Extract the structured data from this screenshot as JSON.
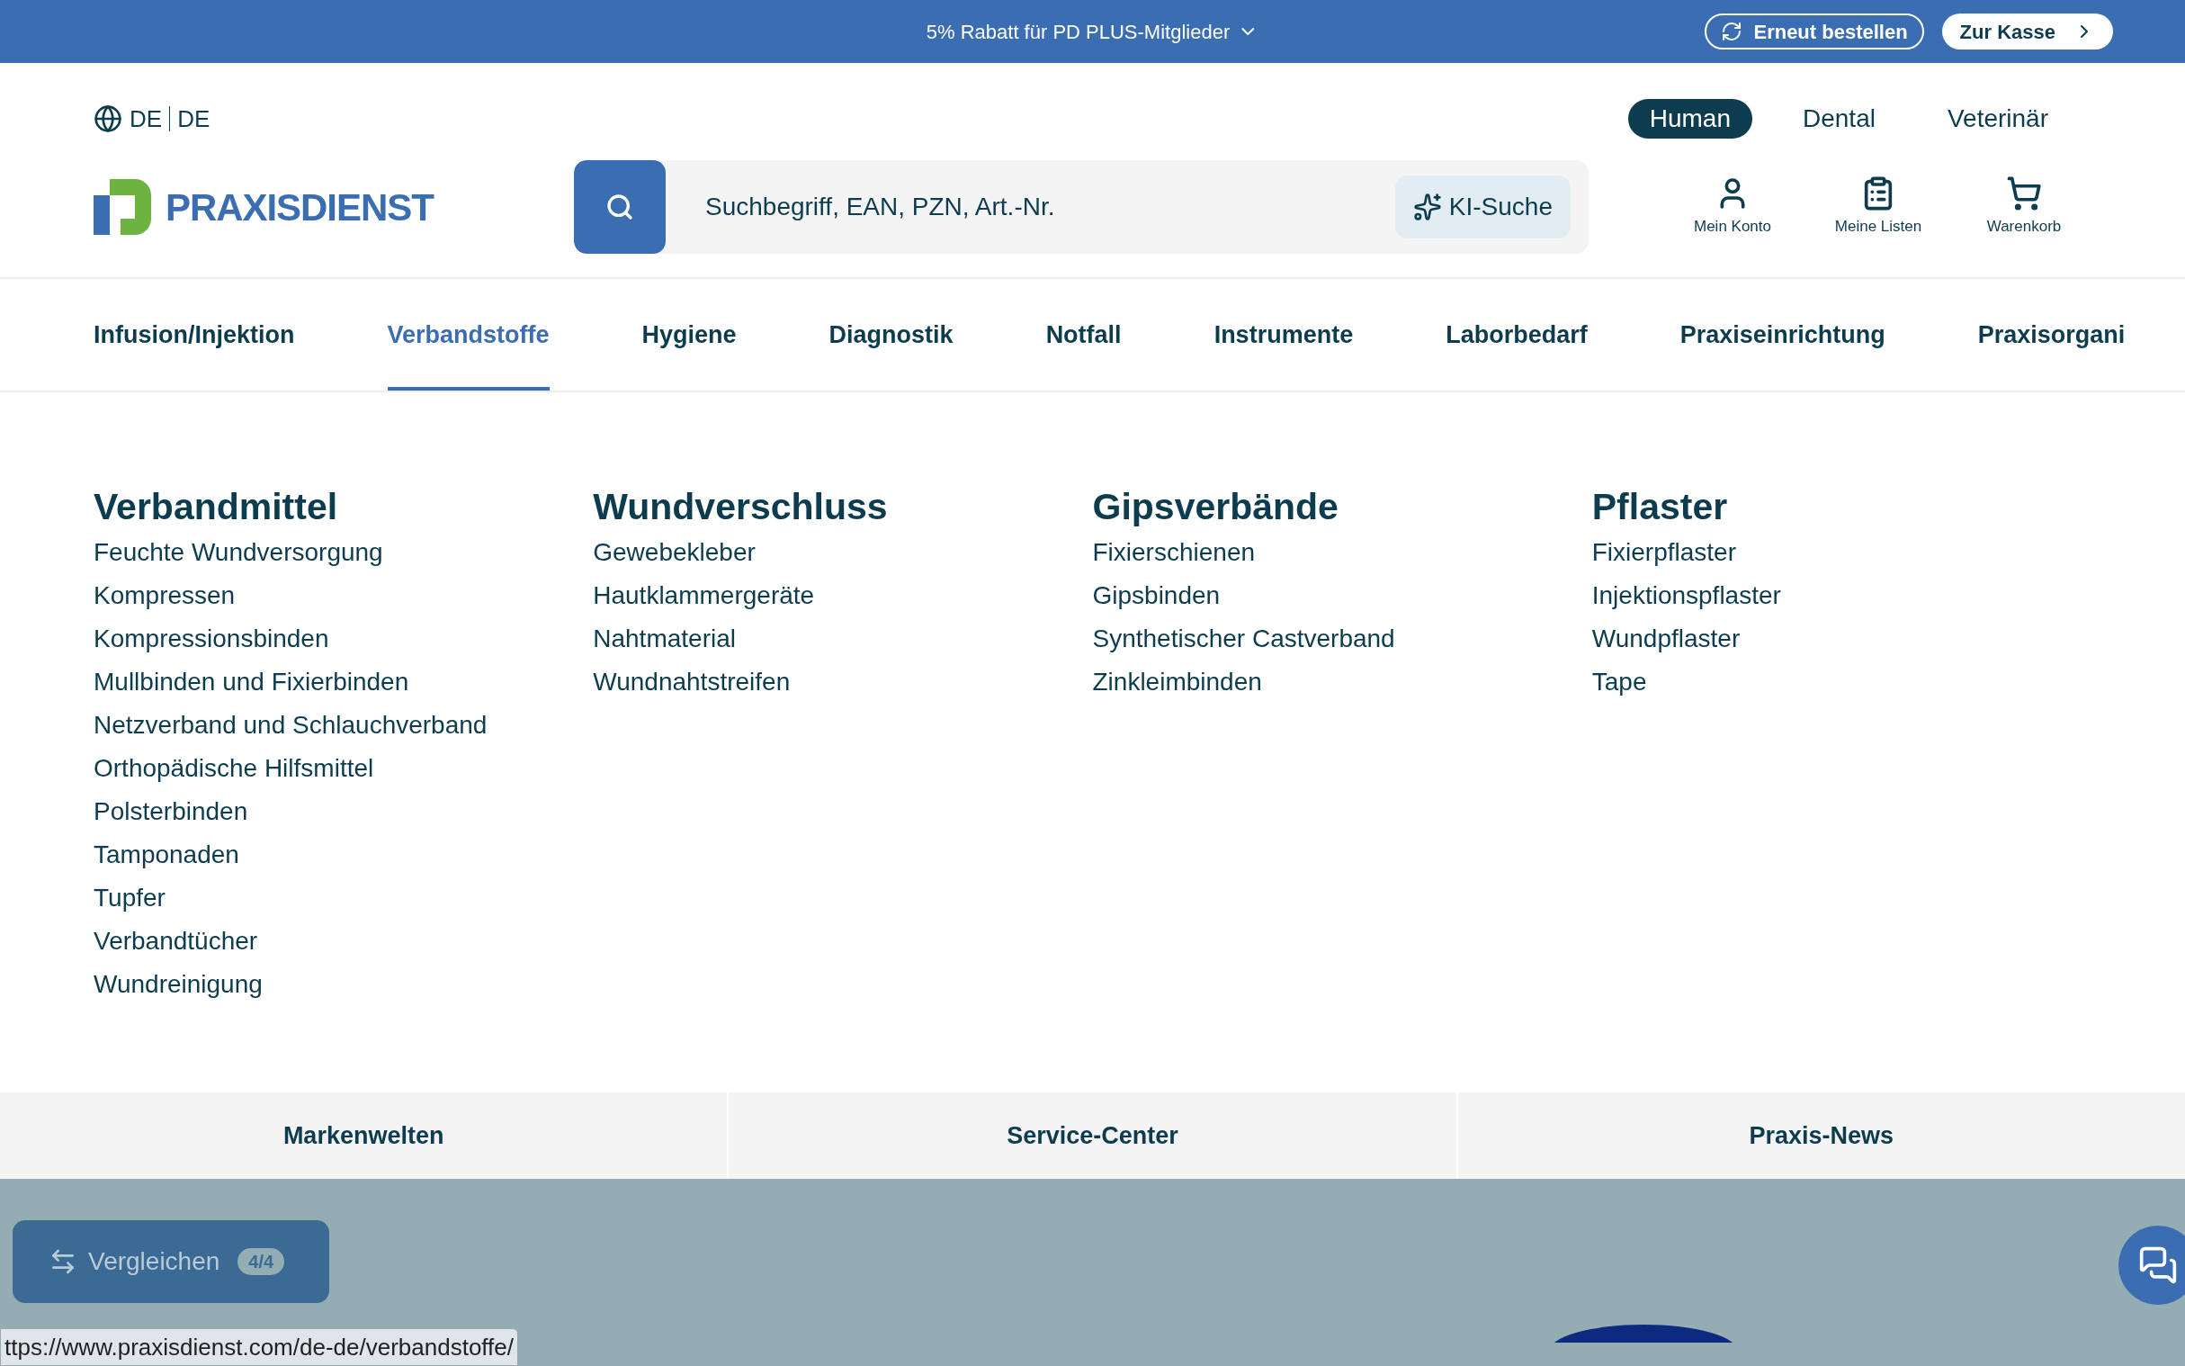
{
  "promo_bar": {
    "text": "5% Rabatt für PD PLUS-Mitglieder",
    "buttons": [
      {
        "kind": "reorder",
        "label": "Erneut bestellen"
      },
      {
        "kind": "checkout",
        "label": "Zur Kasse"
      }
    ]
  },
  "language": {
    "language": "DE",
    "country": "DE"
  },
  "segments": [
    {
      "label": "Human",
      "selected": true
    },
    {
      "label": "Dental",
      "selected": false
    },
    {
      "label": "Veterinär",
      "selected": false
    }
  ],
  "logo": {
    "text": "PRAXISDIENST"
  },
  "search": {
    "placeholder": "Suchbegriff, EAN, PZN, Art.-Nr.",
    "ai_button": "KI-Suche"
  },
  "account_links": [
    {
      "kind": "account",
      "label": "Mein Konto"
    },
    {
      "kind": "lists",
      "label": "Meine Listen"
    },
    {
      "kind": "cart",
      "label": "Warenkorb"
    }
  ],
  "nav": [
    {
      "label": "Infusion/Injektion",
      "selected": false
    },
    {
      "label": "Verbandstoffe",
      "selected": true
    },
    {
      "label": "Hygiene",
      "selected": false
    },
    {
      "label": "Diagnostik",
      "selected": false
    },
    {
      "label": "Notfall",
      "selected": false
    },
    {
      "label": "Instrumente",
      "selected": false
    },
    {
      "label": "Laborbedarf",
      "selected": false
    },
    {
      "label": "Praxiseinrichtung",
      "selected": false
    },
    {
      "label": "Praxisorgani",
      "selected": false
    }
  ],
  "mega_menu": [
    {
      "heading": "Verbandmittel",
      "links": [
        "Feuchte Wundversorgung",
        "Kompressen",
        "Kompressionsbinden",
        "Mullbinden und Fixierbinden",
        "Netzverband und Schlauchverband",
        "Orthopädische Hilfsmittel",
        "Polsterbinden",
        "Tamponaden",
        "Tupfer",
        "Verbandtücher",
        "Wundreinigung"
      ]
    },
    {
      "heading": "Wundverschluss",
      "links": [
        "Gewebekleber",
        "Hautklammergeräte",
        "Nahtmaterial",
        "Wundnahtstreifen"
      ]
    },
    {
      "heading": "Gipsverbände",
      "links": [
        "Fixierschienen",
        "Gipsbinden",
        "Synthetischer Castverband",
        "Zinkleimbinden"
      ]
    },
    {
      "heading": "Pflaster",
      "links": [
        "Fixierpflaster",
        "Injektionspflaster",
        "Wundpflaster",
        "Tape"
      ]
    }
  ],
  "bottom_tabs": [
    "Markenwelten",
    "Service-Center",
    "Praxis-News"
  ],
  "compare": {
    "label": "Vergleichen",
    "count": "4/4"
  },
  "status_url": "ttps://www.praxisdienst.com/de-de/verbandstoffe/"
}
